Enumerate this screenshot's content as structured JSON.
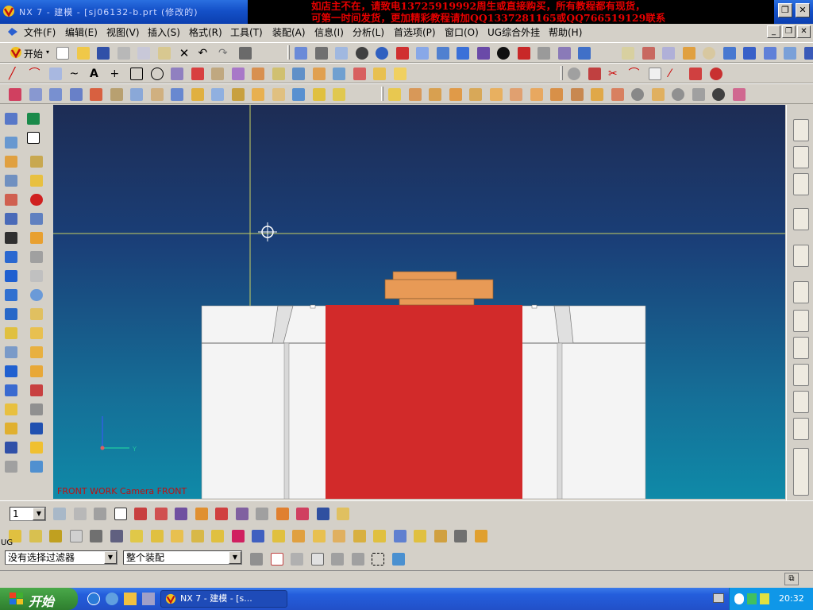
{
  "window": {
    "title": "NX 7 - 建模 - [sj06132-b.prt (修改的)",
    "ad_line1": "如店主不在，请致电13725919992周生或直接购买，所有教程都有现货，",
    "ad_line2": "可第一时间发货，更加精彩教程请加QQ1337281165或QQ766519129联系"
  },
  "menu": {
    "items": [
      "文件(F)",
      "编辑(E)",
      "视图(V)",
      "插入(S)",
      "格式(R)",
      "工具(T)",
      "装配(A)",
      "信息(I)",
      "分析(L)",
      "首选项(P)",
      "窗口(O)",
      "UG综合外挂",
      "帮助(H)"
    ]
  },
  "toolbar": {
    "start_label": "开始"
  },
  "viewport": {
    "label": "FRONT WORK Camera FRONT",
    "colors": {
      "background_top": "#1d2c54",
      "background_bottom": "#0f8aa8",
      "red_block": "#d22a2a",
      "orange_part": "#e89a56",
      "crosshair": "#c8d060"
    }
  },
  "bottom": {
    "layer_value": "1",
    "side_label": "UG",
    "filter_value": "没有选择过滤器",
    "assembly_value": "整个装配"
  },
  "taskbar": {
    "start_label": "开始",
    "task_label": "NX 7 - 建模 - [s...",
    "clock": "20:32"
  },
  "icons": {
    "title": "nx-app-icon",
    "crosshair": "crosshair-cursor-icon"
  }
}
